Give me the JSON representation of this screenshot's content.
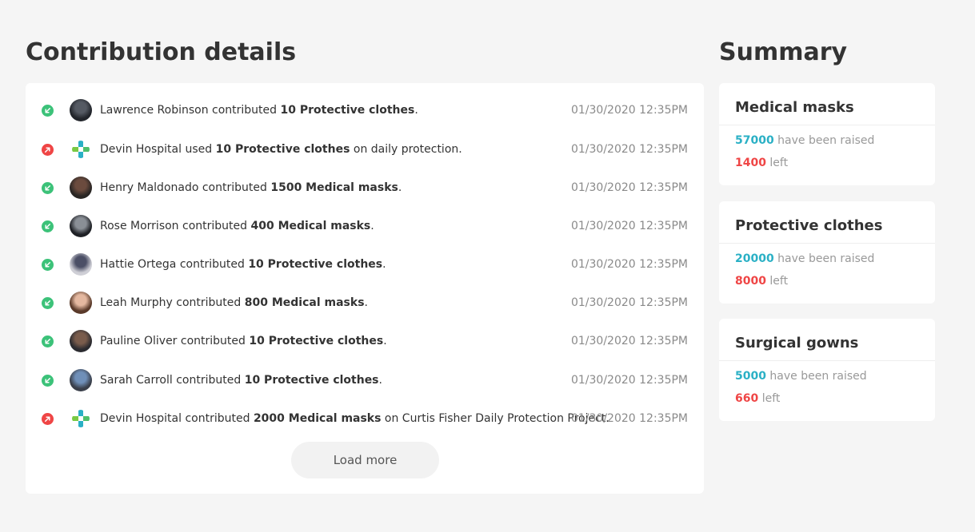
{
  "details": {
    "title": "Contribution details",
    "load_more_label": "Load more",
    "rows": [
      {
        "status": "in",
        "avatar": "person-avatar",
        "pre": "Lawrence Robinson contributed ",
        "bold": "10 Protective clothes",
        "post": ".",
        "time": "01/30/2020 12:35PM"
      },
      {
        "status": "out",
        "avatar": "hospital-logo",
        "pre": "Devin Hospital used ",
        "bold": "10 Protective clothes",
        "post": " on daily protection.",
        "time": "01/30/2020 12:35PM"
      },
      {
        "status": "in",
        "avatar": "person-avatar",
        "pre": "Henry Maldonado contributed ",
        "bold": "1500 Medical masks",
        "post": ".",
        "time": "01/30/2020 12:35PM"
      },
      {
        "status": "in",
        "avatar": "person-avatar",
        "pre": "Rose Morrison contributed ",
        "bold": "400 Medical masks",
        "post": ".",
        "time": "01/30/2020 12:35PM"
      },
      {
        "status": "in",
        "avatar": "person-avatar",
        "pre": "Hattie Ortega contributed ",
        "bold": "10 Protective clothes",
        "post": ".",
        "time": "01/30/2020 12:35PM"
      },
      {
        "status": "in",
        "avatar": "person-avatar",
        "pre": "Leah Murphy contributed ",
        "bold": "800 Medical masks",
        "post": ".",
        "time": "01/30/2020 12:35PM"
      },
      {
        "status": "in",
        "avatar": "person-avatar",
        "pre": "Pauline Oliver contributed ",
        "bold": "10 Protective clothes",
        "post": ".",
        "time": "01/30/2020 12:35PM"
      },
      {
        "status": "in",
        "avatar": "person-avatar",
        "pre": "Sarah Carroll contributed ",
        "bold": "10 Protective clothes",
        "post": ".",
        "time": "01/30/2020 12:35PM"
      },
      {
        "status": "out",
        "avatar": "hospital-logo",
        "pre": "Devin Hospital contributed ",
        "bold": "2000 Medical masks",
        "post": " on Curtis Fisher Daily Protection Project.",
        "time": "01/30/2020 12:35PM"
      }
    ]
  },
  "summary": {
    "title": "Summary",
    "raised_suffix": "have been raised",
    "left_suffix": "left",
    "items": [
      {
        "name": "Medical masks",
        "raised": "57000",
        "left": "1400"
      },
      {
        "name": "Protective clothes",
        "raised": "20000",
        "left": "8000"
      },
      {
        "name": "Surgical gowns",
        "raised": "5000",
        "left": "660"
      }
    ]
  },
  "colors": {
    "in": "#3cc279",
    "out": "#ef4545",
    "raised": "#2ab0c5",
    "left": "#ef4545"
  },
  "icons": {
    "in": "arrow-down-left-icon",
    "out": "arrow-up-right-icon"
  }
}
